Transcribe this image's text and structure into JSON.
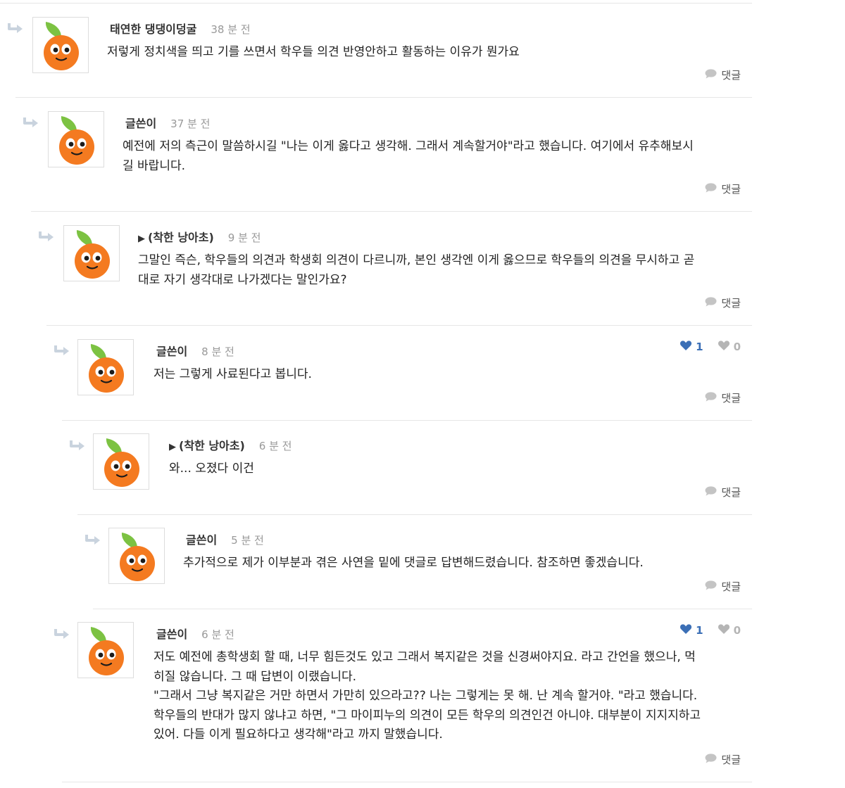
{
  "comments": [
    {
      "author": "태연한 댕댕이덩굴",
      "author_prefix": "",
      "time": "38 분 전",
      "body": "저렇게 정치색을 띄고 기를 쓰면서 학우들 의견 반영안하고 활동하는 이유가 뭔가요",
      "reply_label": "댓글",
      "votes": null
    },
    {
      "author": "글쓴이",
      "author_prefix": "",
      "time": "37 분 전",
      "body": "예전에 저의 측근이 말씀하시길 \"나는 이게 옳다고 생각해. 그래서 계속할거야\"라고 했습니다. 여기에서 유추해보시\n길 바랍니다.",
      "reply_label": "댓글",
      "votes": null
    },
    {
      "author": "(착한 낭아초)",
      "author_prefix": "▶",
      "time": "9 분 전",
      "body": "그말인 즉슨, 학우들의 의견과 학생회 의견이 다르니까, 본인 생각엔 이게 옳으므로 학우들의 의견을 무시하고 곧\n대로 자기 생각대로 나가겠다는 말인가요?",
      "reply_label": "댓글",
      "votes": null
    },
    {
      "author": "글쓴이",
      "author_prefix": "",
      "time": "8 분 전",
      "body": "저는 그렇게 사료된다고 봅니다.",
      "reply_label": "댓글",
      "votes": {
        "likes": "1",
        "dislikes": "0"
      }
    },
    {
      "author": "(착한 낭아초)",
      "author_prefix": "▶",
      "time": "6 분 전",
      "body": "와... 오졌다 이건",
      "reply_label": "댓글",
      "votes": null
    },
    {
      "author": "글쓴이",
      "author_prefix": "",
      "time": "5 분 전",
      "body": "추가적으로 제가 이부분과 겪은 사연을 밑에 댓글로 답변해드렸습니다. 참조하면 좋겠습니다.",
      "reply_label": "댓글",
      "votes": null
    },
    {
      "author": "글쓴이",
      "author_prefix": "",
      "time": "6 분 전",
      "body": "저도 예전에 총학생회 할 때, 너무 힘든것도 있고 그래서 복지같은 것을 신경써야지요. 라고 간언을 했으나, 먹\n히질 않습니다. 그 때 답변이 이랬습니다.\n\"그래서 그냥 복지같은 거만 하면서 가만히 있으라고?? 나는 그렇게는 못 해. 난 계속 할거야. \"라고 했습니다.\n학우들의 반대가 많지 않냐고 하면, \"그 마이피누의 의견이 모든 학우의 의견인건 아니야. 대부분이 지지지하고\n있어. 다들 이게 필요하다고 생각해\"라고 까지 말했습니다.",
      "reply_label": "댓글",
      "votes": {
        "likes": "1",
        "dislikes": "0"
      }
    }
  ],
  "colors": {
    "like": "#3b6fb6",
    "dislike": "#b5b5b5",
    "orange": "#f47a20",
    "leaf": "#7cc242",
    "reply_arrow": "#c9d3de"
  }
}
